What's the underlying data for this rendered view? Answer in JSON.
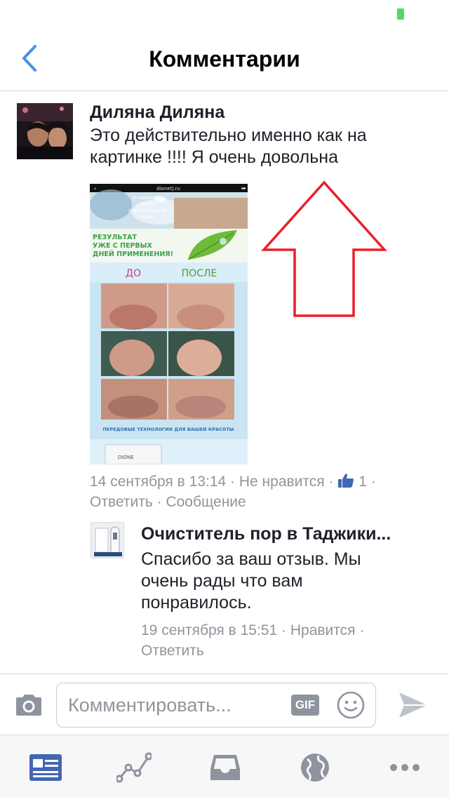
{
  "header": {
    "title": "Комментарии"
  },
  "comment": {
    "author": "Диляна Диляна",
    "text": "Это действительно именно как на картинке !!!! Я очень довольна",
    "attachment": {
      "site": "dionetj.ru",
      "top_caption": "и нанесите любой увлажняющий крем",
      "headline": "РЕЗУЛЬТАТ УЖЕ С ПЕРВЫХ ДНЕЙ ПРИМЕНЕНИЯ!",
      "before_label": "ДО",
      "after_label": "ПОСЛЕ",
      "footer_caption": "ПЕРЕДОВЫЕ ТЕХНОЛОГИИ ДЛЯ ВАШЕЙ КРАСОТЫ",
      "product_brand": "DIONE"
    },
    "timestamp": "14 сентября в 13:14",
    "unlike_label": "Не нравится",
    "like_count": "1",
    "reply_label": "Ответить",
    "message_label": "Сообщение"
  },
  "reply": {
    "author": "Очиститель пор в Таджики...",
    "text": "Спасибо за ваш отзыв. Мы очень рады что вам понравилось.",
    "timestamp": "19 сентября в 15:51",
    "like_label": "Нравится",
    "reply_label": "Ответить"
  },
  "composer": {
    "placeholder": "Комментировать...",
    "gif_label": "GIF"
  },
  "tab_bar": {
    "items": [
      {
        "icon": "news-feed-icon",
        "active": true
      },
      {
        "icon": "activity-chart-icon",
        "active": false
      },
      {
        "icon": "inbox-icon",
        "active": false
      },
      {
        "icon": "globe-icon",
        "active": false
      },
      {
        "icon": "more-icon",
        "active": false
      }
    ]
  },
  "colors": {
    "accent": "#4267b2",
    "back_arrow": "#4a90e2",
    "annotation_arrow": "#e8202a",
    "meta_text": "#90949c",
    "battery": "#4cd964"
  }
}
